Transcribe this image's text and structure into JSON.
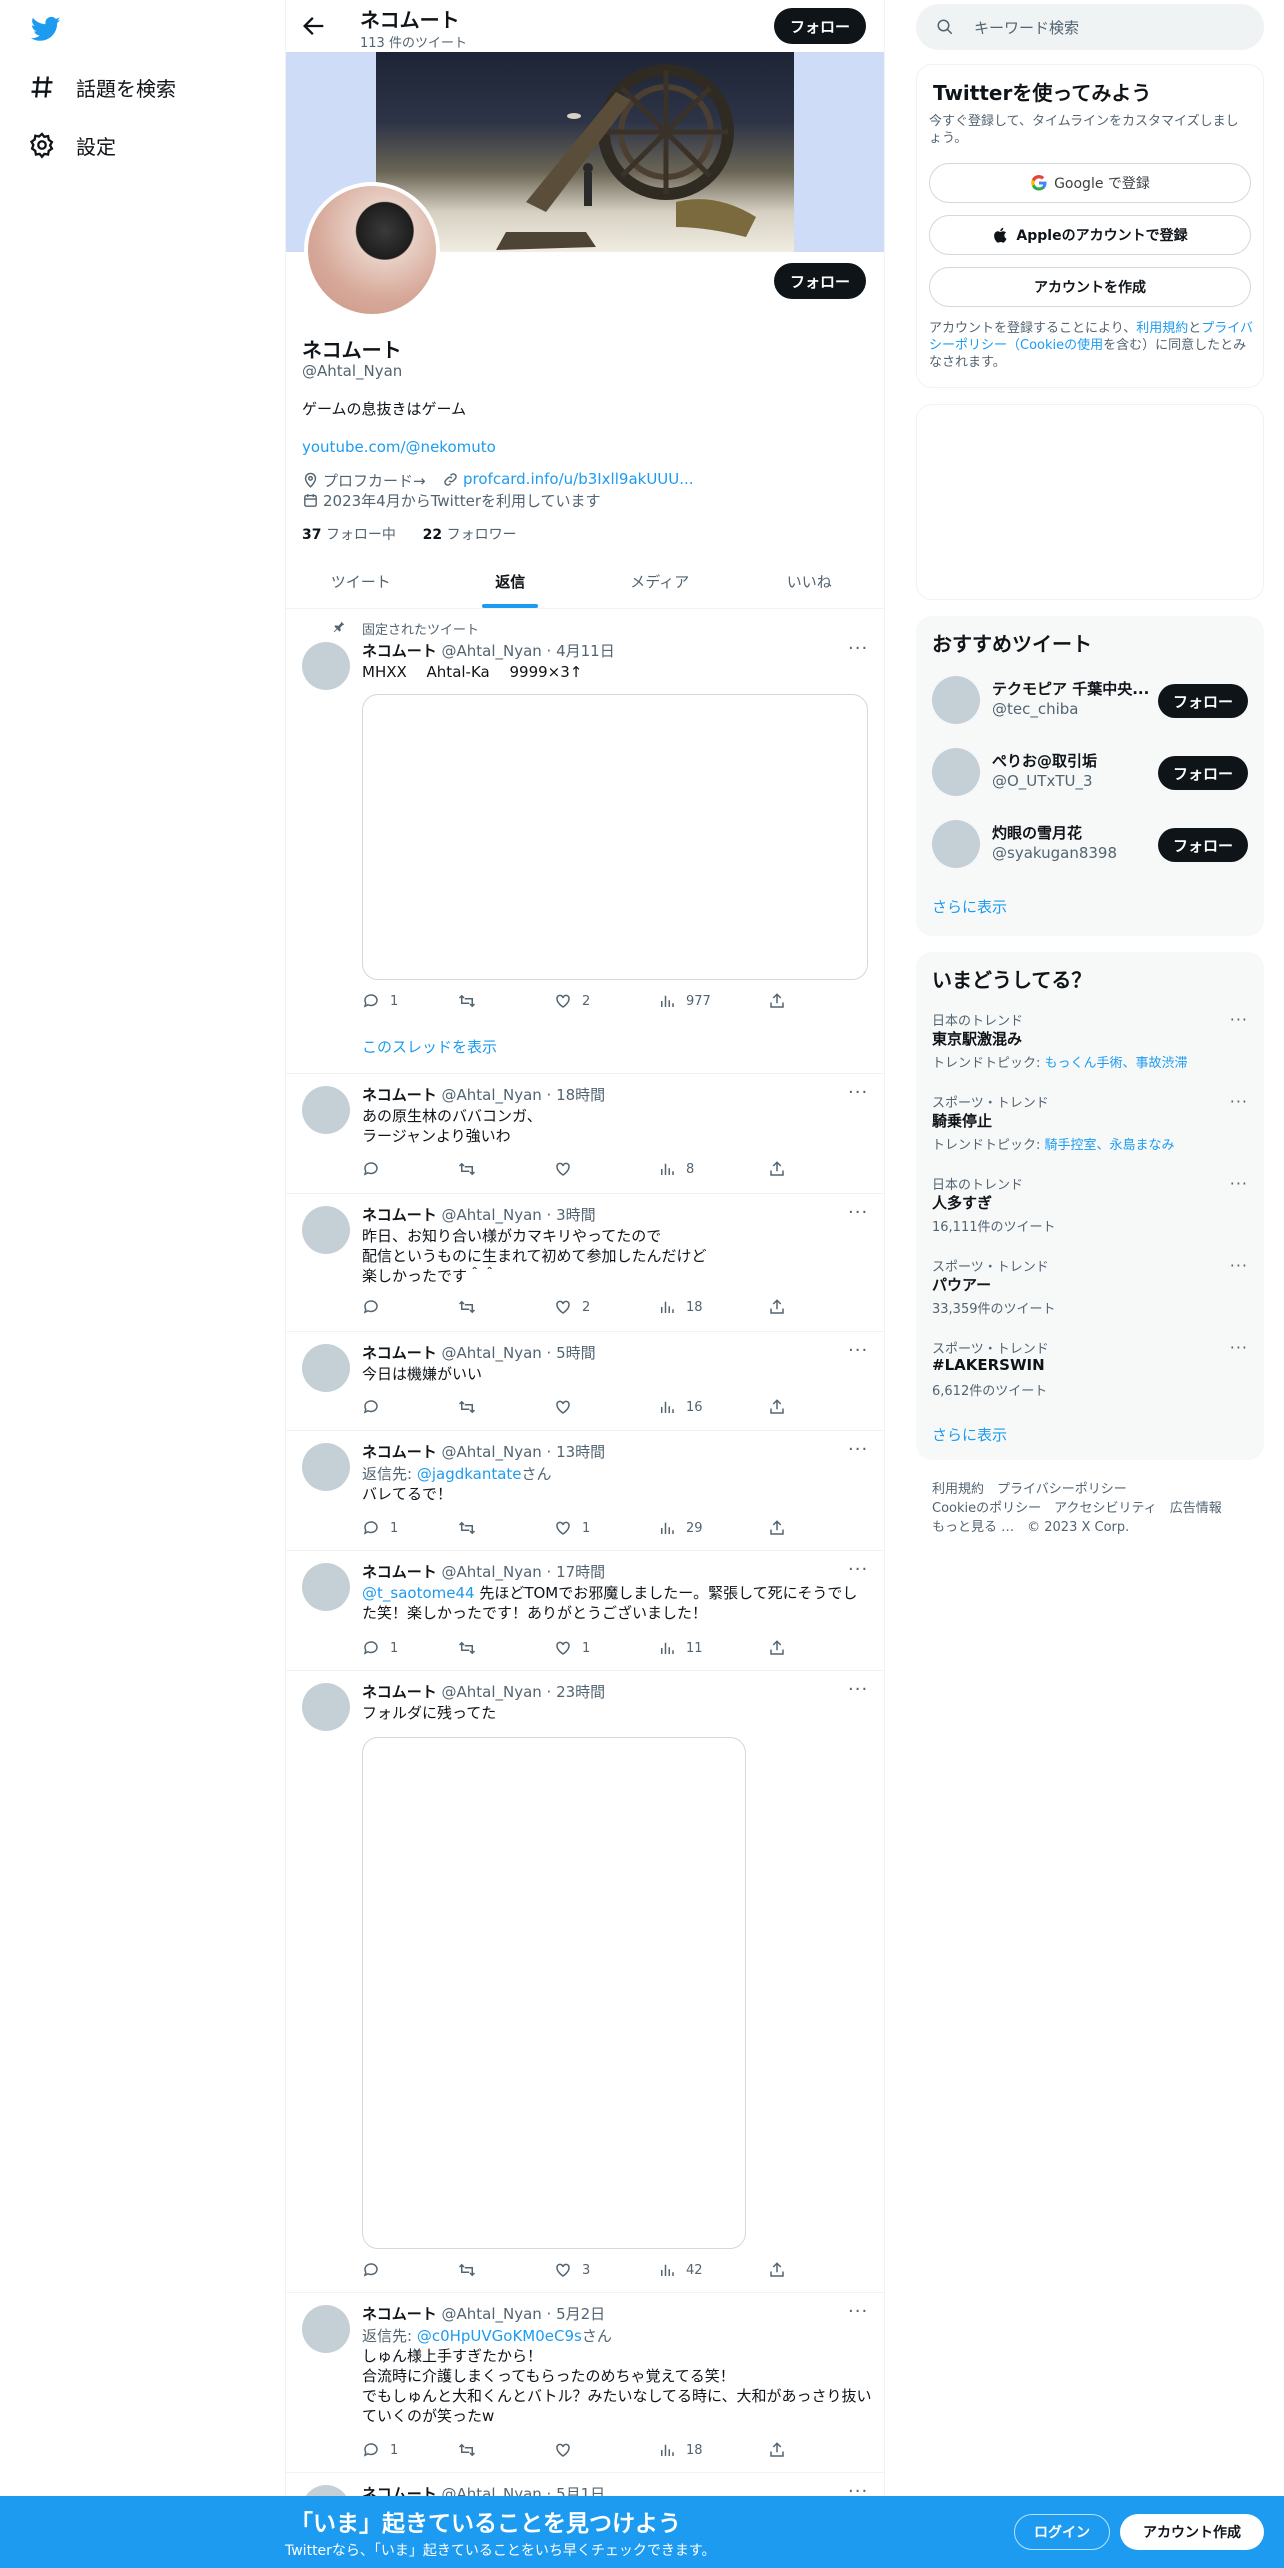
{
  "nav": {
    "explore_label": "話題を検索",
    "settings_label": "設定"
  },
  "profile": {
    "name": "ネコムート",
    "tweet_count": "113 件のツイート",
    "follow_label": "フォロー",
    "handle": "@Ahtal_Nyan",
    "bio": "ゲームの息抜きはゲーム",
    "link": "youtube.com/@nekomuto",
    "profile_card": "プロフカード→",
    "profile_card_link": "profcard.info/u/b3Ixll9akUUU...",
    "joined": "2023年4月からTwitterを利用しています",
    "following_count": "37",
    "following_label": "フォロー中",
    "followers_count": "22",
    "followers_label": "フォロワー"
  },
  "tabs": [
    {
      "label": "ツイート"
    },
    {
      "label": "返信"
    },
    {
      "label": "メディア"
    },
    {
      "label": "いいね"
    }
  ],
  "tweets": [
    {
      "pinned_label": "固定されたツイート",
      "name": "ネコムート",
      "meta": "@Ahtal_Nyan · 4月11日",
      "body": "MHXX　 Ahtal-Ka　 9999×3↑",
      "reply": "1",
      "retweet": "",
      "like": "2",
      "views": "977",
      "thread_link": "このスレッドを表示"
    },
    {
      "name": "ネコムート",
      "meta": "@Ahtal_Nyan · 18時間",
      "body": "あの原生林のババコンガ、\nラージャンより強いわ",
      "reply": "",
      "retweet": "",
      "like": "",
      "views": "8"
    },
    {
      "name": "ネコムート",
      "meta": "@Ahtal_Nyan · 3時間",
      "body": "昨日、お知り合い様がカマキリやってたので\n配信というものに生まれて初めて参加したんだけど\n楽しかったです＾＾",
      "reply": "",
      "retweet": "",
      "like": "2",
      "views": "18"
    },
    {
      "name": "ネコムート",
      "meta": "@Ahtal_Nyan · 5時間",
      "body": "今日は機嫌がいい",
      "reply": "",
      "retweet": "",
      "like": "",
      "views": "16"
    },
    {
      "name": "ネコムート",
      "meta": "@Ahtal_Nyan · 13時間",
      "reply_prefix": "返信先: ",
      "reply_to": "@jagdkantate",
      "reply_suffix": "さん",
      "body": "バレてるで！",
      "reply": "1",
      "retweet": "",
      "like": "1",
      "views": "29"
    },
    {
      "name": "ネコムート",
      "meta": "@Ahtal_Nyan · 17時間",
      "mention": "@t_saotome44",
      "body": " 先ほどTOMでお邪魔しましたー。緊張して死にそうでした笑！楽しかったです！ありがとうございました！",
      "reply": "1",
      "retweet": "",
      "like": "1",
      "views": "11"
    },
    {
      "name": "ネコムート",
      "meta": "@Ahtal_Nyan · 23時間",
      "body": "フォルダに残ってた",
      "reply": "",
      "retweet": "",
      "like": "3",
      "views": "42"
    },
    {
      "name": "ネコムート",
      "meta": "@Ahtal_Nyan · 5月2日",
      "reply_prefix": "返信先: ",
      "reply_to": "@c0HpUVGoKM0eC9s",
      "reply_suffix": "さん",
      "body": "しゅん様上手すぎたから！\n合流時に介護しまくってもらったのめちゃ覚えてる笑！\nでもしゅんと大和くんとバトル？みたいなしてる時に、大和があっさり抜いていくのが笑ったw",
      "reply": "1",
      "retweet": "",
      "like": "",
      "views": "18"
    },
    {
      "name": "ネコムート",
      "meta": "@Ahtal_Nyan · 5月1日"
    }
  ],
  "right": {
    "search_placeholder": "キーワード検索",
    "signup": {
      "title": "Twitterを使ってみよう",
      "subtitle": "今すぐ登録して、タイムラインをカスタマイズしましょう。",
      "google": "Google で登録",
      "apple": "Appleのアカウントで登録",
      "create": "アカウントを作成",
      "terms_1": "アカウントを登録することにより、",
      "terms_link1": "利用規約",
      "terms_2": "と",
      "terms_link2": "プライバシーポリシー（Cookieの使用",
      "terms_3": "を含む）に同意したとみなされます。"
    },
    "recommended": {
      "title": "おすすめツイート",
      "follow_label": "フォロー",
      "users": [
        {
          "name": "テクモピア 千葉中央...",
          "handle": "@tec_chiba"
        },
        {
          "name": "ぺりお@取引垢",
          "handle": "@O_UTxTU_3"
        },
        {
          "name": "灼眼の雪月花",
          "handle": "@syakugan8398"
        }
      ],
      "show_more": "さらに表示"
    },
    "trends": {
      "title": "いまどうしてる？",
      "items": [
        {
          "meta": "日本のトレンド",
          "name": "東京駅激混み",
          "sub_prefix": "トレンドトピック: ",
          "sub_links": "もっくん手術、事故渋滞"
        },
        {
          "meta": "スポーツ・トレンド",
          "name": "騎乗停止",
          "sub_prefix": "トレンドトピック: ",
          "sub_links": "騎手控室、永島まなみ"
        },
        {
          "meta": "日本のトレンド",
          "name": "人多すぎ",
          "sub_prefix": "16,111件のツイート",
          "sub_links": ""
        },
        {
          "meta": "スポーツ・トレンド",
          "name": "パウアー",
          "sub_prefix": "33,359件のツイート",
          "sub_links": ""
        },
        {
          "meta": "スポーツ・トレンド",
          "name": "#LAKERSWIN",
          "sub_prefix": "6,612件のツイート",
          "sub_links": ""
        }
      ],
      "show_more": "さらに表示"
    },
    "footer": {
      "line1": "利用規約　プライバシーポリシー",
      "line2": "Cookieのポリシー　アクセシビリティ　広告情報",
      "line3": "もっと見る …　© 2023 X Corp."
    }
  },
  "bottombar": {
    "title": "「いま」起きていることを見つけよう",
    "subtitle": "Twitterなら、「いま」起きていることをいち早くチェックできます。",
    "login": "ログイン",
    "signup": "アカウント作成"
  },
  "colors": {
    "accent": "#1d9bf0",
    "text": "#0f1419",
    "muted": "#536471"
  }
}
